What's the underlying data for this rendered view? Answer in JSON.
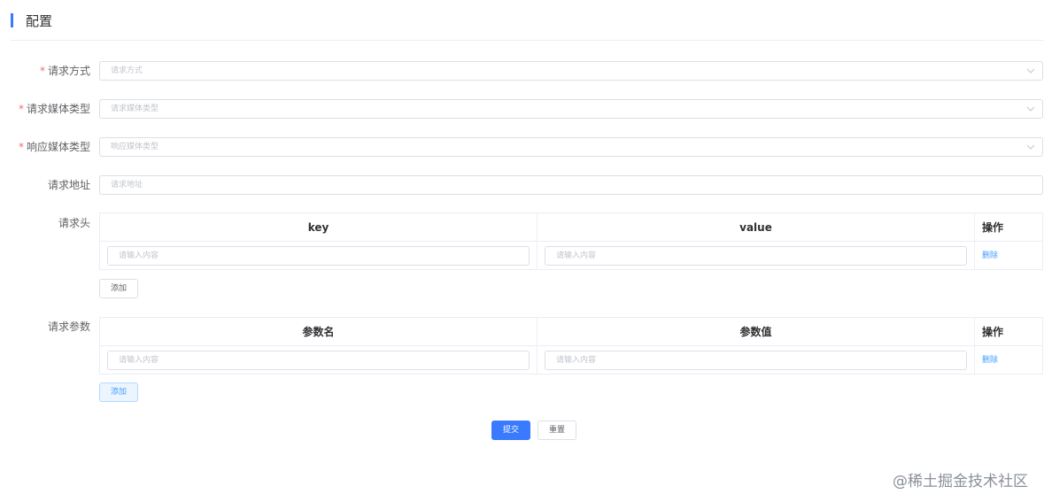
{
  "header": {
    "title": "配置"
  },
  "form": {
    "request_method": {
      "required": "*",
      "label": "请求方式",
      "placeholder": "请求方式"
    },
    "request_media_type": {
      "required": "*",
      "label": "请求媒体类型",
      "placeholder": "请求媒体类型"
    },
    "response_media_type": {
      "required": "*",
      "label": "响应媒体类型",
      "placeholder": "响应媒体类型"
    },
    "request_url": {
      "label": "请求地址",
      "placeholder": "请求地址"
    },
    "headers": {
      "label": "请求头",
      "columns": [
        "key",
        "value",
        "操作"
      ],
      "rows": [
        {
          "key_placeholder": "请输入内容",
          "value_placeholder": "请输入内容",
          "action": "删除"
        }
      ],
      "add_label": "添加"
    },
    "params": {
      "label": "请求参数",
      "columns": [
        "参数名",
        "参数值",
        "操作"
      ],
      "rows": [
        {
          "key_placeholder": "请输入内容",
          "value_placeholder": "请输入内容",
          "action": "删除"
        }
      ],
      "add_label": "添加"
    },
    "submit_label": "提交",
    "reset_label": "重置"
  },
  "watermark": "@稀土掘金技术社区",
  "colors": {
    "accent": "#3a7afe",
    "required": "#f56c6c",
    "link": "#409eff"
  }
}
